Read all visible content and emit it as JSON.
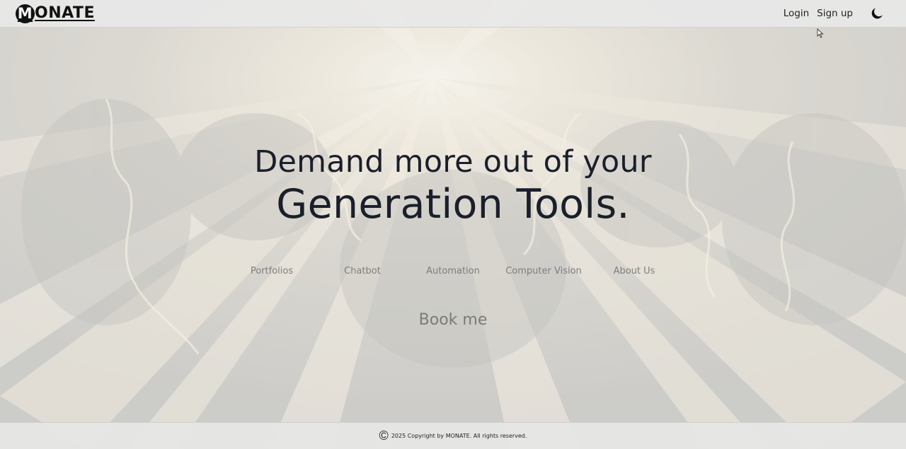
{
  "header": {
    "logo_mark": "M",
    "logo_rest": "ONATE",
    "login_label": "Login",
    "signup_label": "Sign up",
    "theme_icon": "moon-icon"
  },
  "hero": {
    "line1": "Demand more out of your",
    "line2": "Generation Tools."
  },
  "links": [
    {
      "label": "Portfolios"
    },
    {
      "label": "Chatbot"
    },
    {
      "label": "Automation"
    },
    {
      "label": "Computer Vision"
    },
    {
      "label": "About Us"
    }
  ],
  "book": {
    "label": "Book me"
  },
  "footer": {
    "symbol": "©",
    "text": "2025 Copyright by MONATE. All rights reserved."
  },
  "colors": {
    "text_dark": "#1a1f2b",
    "link_gray": "#7e7e7e",
    "header_bg": "#e8e8e8"
  }
}
